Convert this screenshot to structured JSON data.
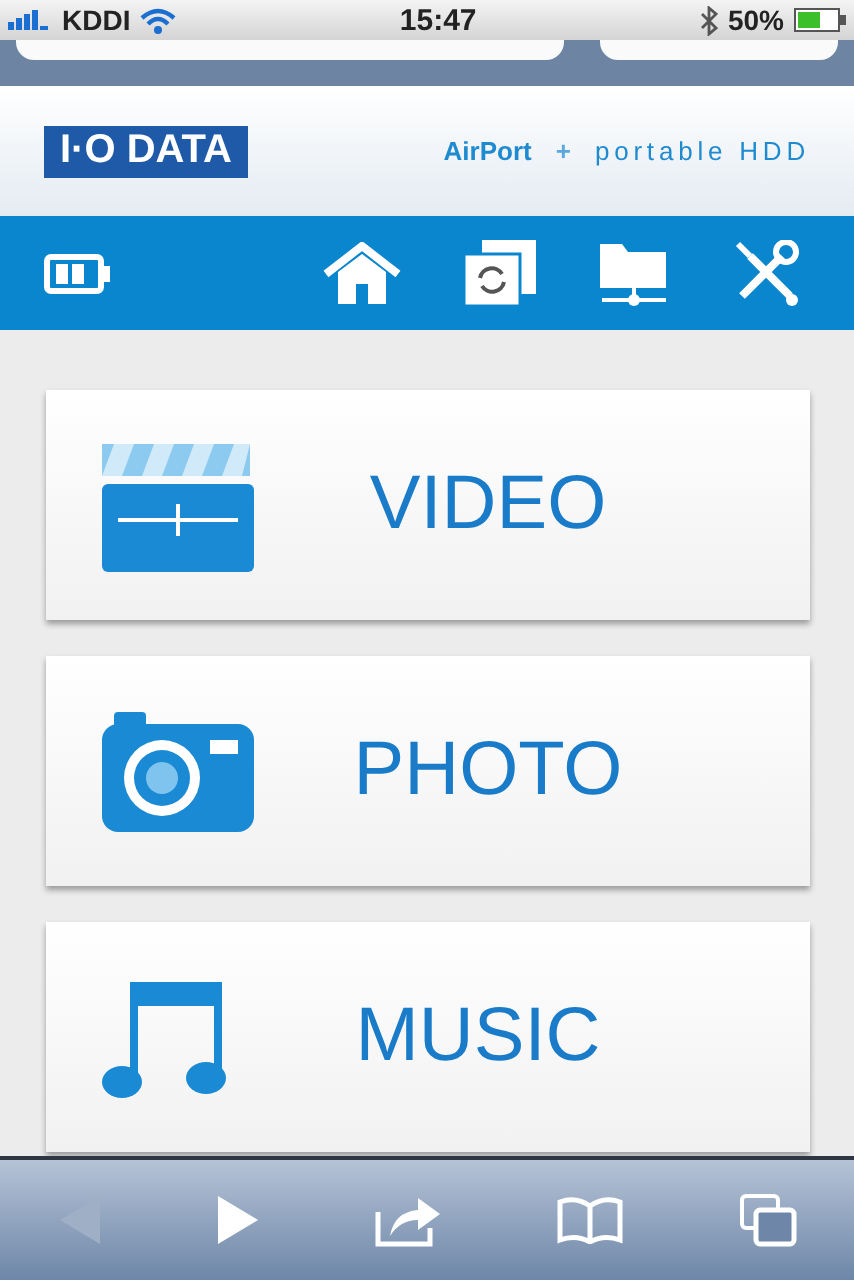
{
  "status_bar": {
    "carrier": "KDDI",
    "time": "15:47",
    "battery": "50%"
  },
  "header": {
    "logo": "I·O DATA",
    "product": "AirPort",
    "plus": "+",
    "subtitle": "portable HDD"
  },
  "menu": [
    {
      "kind": "video",
      "label": "VIDEO"
    },
    {
      "kind": "photo",
      "label": "PHOTO"
    },
    {
      "kind": "music",
      "label": "MUSIC"
    }
  ],
  "browser_bar": {
    "back_disabled": true,
    "forward_disabled": false
  }
}
